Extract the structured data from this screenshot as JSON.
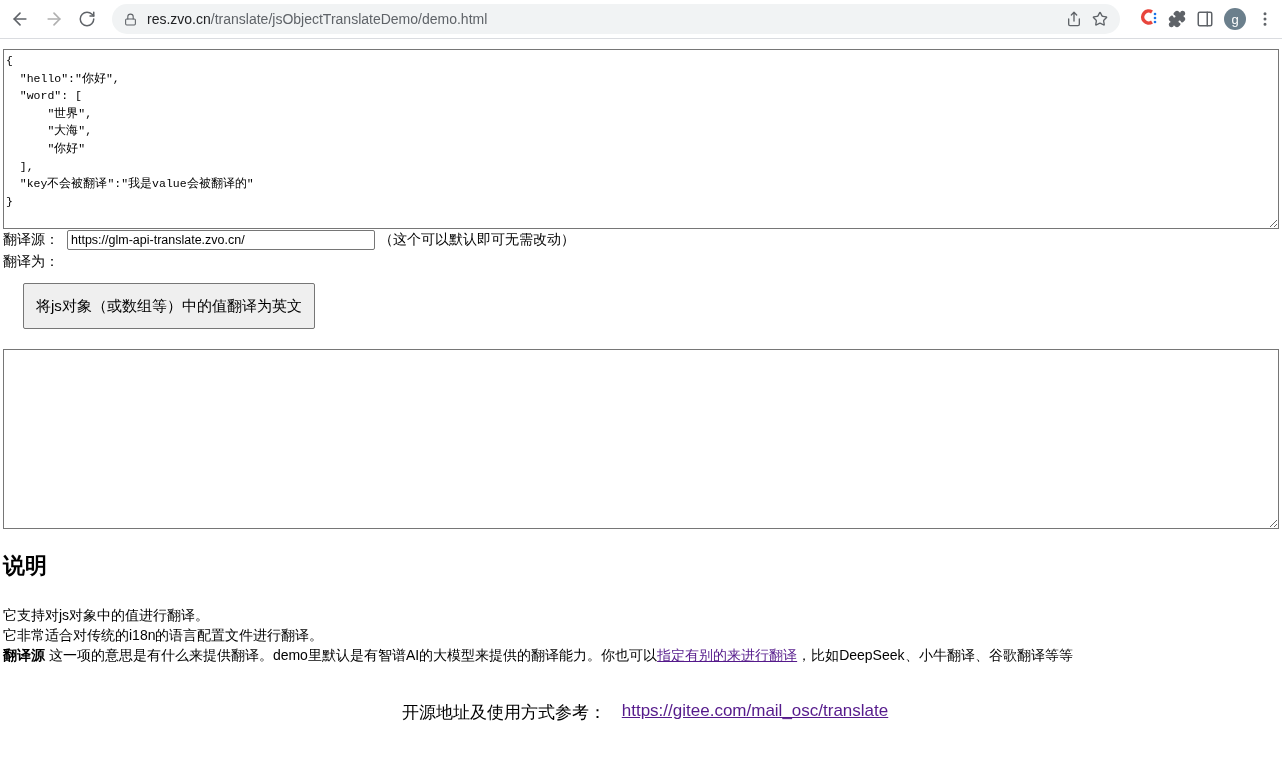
{
  "browser": {
    "url_host": "res.zvo.cn",
    "url_path": "/translate/jsObjectTranslateDemo/demo.html",
    "forward_disabled": true,
    "avatar_letter": "g"
  },
  "source_editor": {
    "value": "{\n  \"hello\":\"你好\",\n  \"word\": [\n      \"世界\",\n      \"大海\",\n      \"你好\"\n  ],\n  \"key不会被翻译\":\"我是value会被翻译的\"\n}"
  },
  "source_row": {
    "label": "翻译源：",
    "value": "https://glm-api-translate.zvo.cn/",
    "note": "（这个可以默认即可无需改动）"
  },
  "target_row": {
    "label": "翻译为："
  },
  "translate_button": "将js对象（或数组等）中的值翻译为英文",
  "section_title": "说明",
  "paragraphs": [
    {
      "kind": "text",
      "text": "它支持对js对象中的值进行翻译。"
    },
    {
      "kind": "text",
      "text": "它非常适合对传统的i18n的语言配置文件进行翻译。"
    },
    {
      "kind": "link",
      "lead": "翻译源",
      "before": " 这一项的意思是有什么来提供翻译。demo里默认是有智谱AI的大模型来提供的翻译能力。你也可以",
      "link": "指定有别的来进行翻译",
      "after": "，比如DeepSeek、小牛翻译、谷歌翻译等等"
    }
  ],
  "footer": {
    "label": "开源地址及使用方式参考：",
    "link": "https://gitee.com/mail_osc/translate"
  }
}
